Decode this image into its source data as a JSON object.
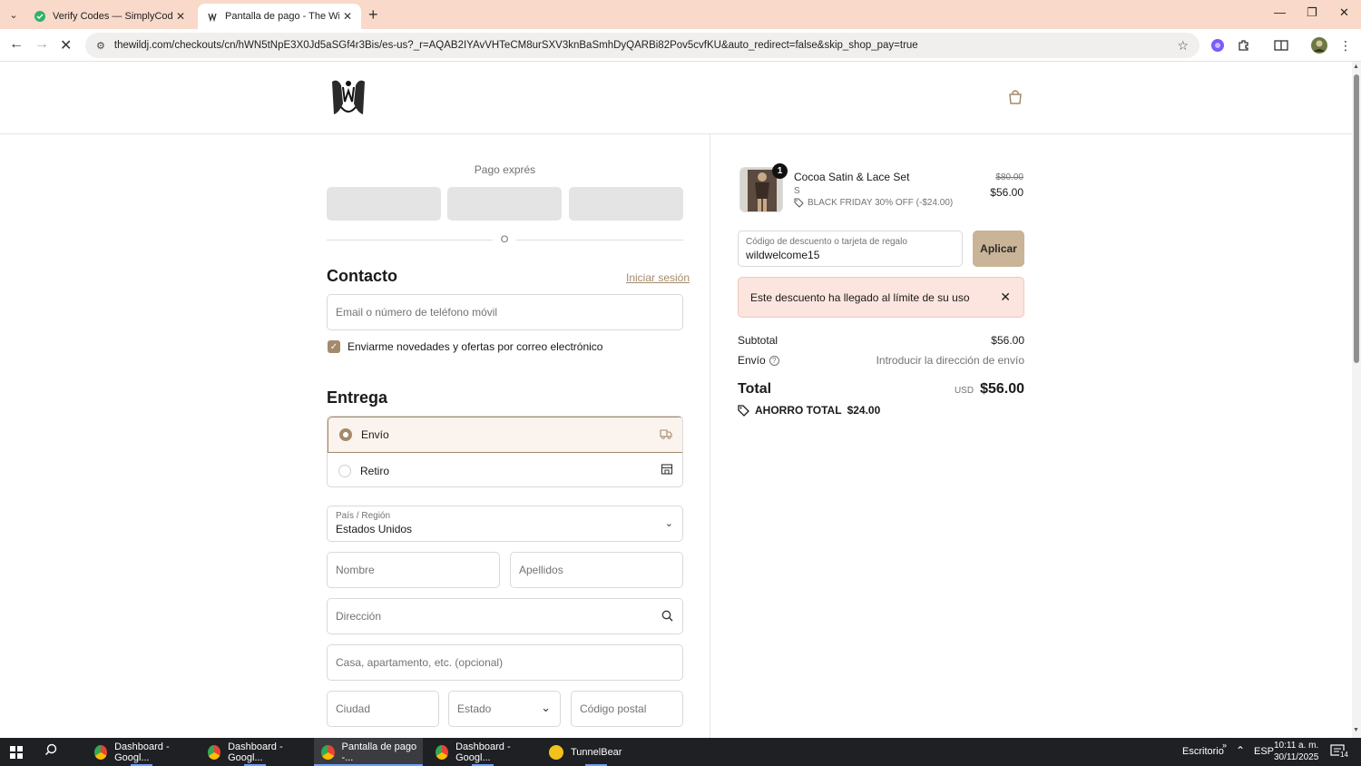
{
  "browser": {
    "tabs": [
      {
        "title": "Verify Codes — SimplyCodes",
        "active": false
      },
      {
        "title": "Pantalla de pago - The Wild J",
        "active": true
      }
    ],
    "url": "thewildj.com/checkouts/cn/hWN5tNpE3X0Jd5aSGf4r3Bis/es-us?_r=AQAB2IYAvVHTeCM8urSXV3knBaSmhDyQARBi82Pov5cvfKU&auto_redirect=false&skip_shop_pay=true"
  },
  "checkout": {
    "express": {
      "title": "Pago exprés",
      "or": "O"
    },
    "contact": {
      "title": "Contacto",
      "login_link": "Iniciar sesión",
      "email_placeholder": "Email o número de teléfono móvil",
      "newsletter_label": "Enviarme novedades y ofertas por correo electrónico",
      "newsletter_checked": true
    },
    "delivery": {
      "title": "Entrega",
      "options": [
        {
          "label": "Envío",
          "selected": true,
          "icon": "truck-icon"
        },
        {
          "label": "Retiro",
          "selected": false,
          "icon": "store-icon"
        }
      ],
      "country_label": "País / Región",
      "country_value": "Estados Unidos",
      "first_name_placeholder": "Nombre",
      "last_name_placeholder": "Apellidos",
      "address_placeholder": "Dirección",
      "apartment_placeholder": "Casa, apartamento, etc. (opcional)",
      "city_placeholder": "Ciudad",
      "state_placeholder": "Estado",
      "zip_placeholder": "Código postal"
    }
  },
  "summary": {
    "item": {
      "quantity": "1",
      "name": "Cocoa Satin & Lace Set",
      "variant": "S",
      "discount": "BLACK FRIDAY 30% OFF (-$24.00)",
      "price_old": "$80.00",
      "price_new": "$56.00"
    },
    "discount_field": {
      "label": "Código de descuento o tarjeta de regalo",
      "value": "wildwelcome15"
    },
    "apply_label": "Aplicar",
    "alert": "Este descuento ha llegado al límite de su uso",
    "subtotal_label": "Subtotal",
    "subtotal_value": "$56.00",
    "shipping_label": "Envío",
    "shipping_value": "Introducir la dirección de envío",
    "total_label": "Total",
    "total_currency": "USD",
    "total_value": "$56.00",
    "savings_label": "AHORRO TOTAL",
    "savings_value": "$24.00"
  },
  "taskbar": {
    "apps": [
      {
        "label": "Dashboard - Googl...",
        "active": false
      },
      {
        "label": "Dashboard - Googl...",
        "active": false
      },
      {
        "label": "Pantalla de pago -...",
        "active": true
      },
      {
        "label": "Dashboard - Googl...",
        "active": false
      },
      {
        "label": "TunnelBear",
        "active": false
      }
    ],
    "desktop_label": "Escritorio",
    "language": "ESP",
    "time": "10:11 a. m.",
    "date": "30/11/2025",
    "notification_count": "14"
  },
  "colors": {
    "accent": "#a48a6c",
    "apply_button": "#c9b497",
    "alert_bg": "#fbe5de",
    "tabbar": "#f9d9c9"
  }
}
